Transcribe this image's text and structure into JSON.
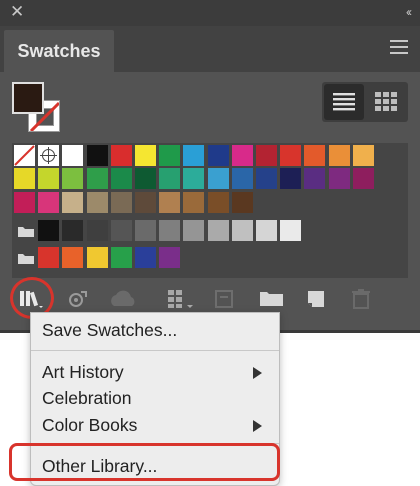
{
  "panel": {
    "tab_label": "Swatches"
  },
  "icons": {
    "close": "close-icon",
    "collapse": "collapse-icon",
    "panel_menu": "hamburger-menu-icon",
    "list_view": "list-view-icon",
    "grid_view": "grid-view-icon"
  },
  "swatches": {
    "row1": [
      "#ffffff",
      "#e6e6e6",
      "#ffffff",
      "#111111",
      "#d92d2d",
      "#f5e631",
      "#1f9a4a",
      "#2a9fd6",
      "#1f3a8a",
      "#d82a8a",
      "#b32332",
      "#d8342c",
      "#e35a2b",
      "#ea8f38",
      "#f0b04c"
    ],
    "row2": [
      "#e6d828",
      "#c4d62c",
      "#7cbf3f",
      "#2f9e4a",
      "#1b8a4a",
      "#0e5a32",
      "#27a070",
      "#2cac9a",
      "#3aa0d0",
      "#2a66a8",
      "#25418a",
      "#1d1f55",
      "#5a2d82",
      "#7e2a80",
      "#8e1e5e"
    ],
    "row3": [
      "#c21e58",
      "#d8357a",
      "#c6b08a",
      "#9c8a6a",
      "#7a6a55",
      "#5e4a3a",
      "#b08050",
      "#9a6a3a",
      "#7a4e28",
      "#5a3820"
    ],
    "row4": [
      "#111111",
      "#2a2a2a",
      "#3f3f3f",
      "#555555",
      "#6a6a6a",
      "#7f7f7f",
      "#959595",
      "#aaaaaa",
      "#c0c0c0",
      "#d5d5d5",
      "#eaeaea"
    ],
    "row5": [
      "#d8342c",
      "#e8622a",
      "#f0c830",
      "#27a04a",
      "#2a3f9a",
      "#7a2e8a"
    ]
  },
  "menu": {
    "items": [
      {
        "label": "Save Swatches...",
        "submenu": false
      },
      {
        "label": "Art History",
        "submenu": true
      },
      {
        "label": "Celebration",
        "submenu": false
      },
      {
        "label": "Color Books",
        "submenu": true
      },
      {
        "label": "Other Library...",
        "submenu": false
      }
    ]
  },
  "accent": {
    "highlight": "#d8342c",
    "panel_bg": "#535353"
  }
}
